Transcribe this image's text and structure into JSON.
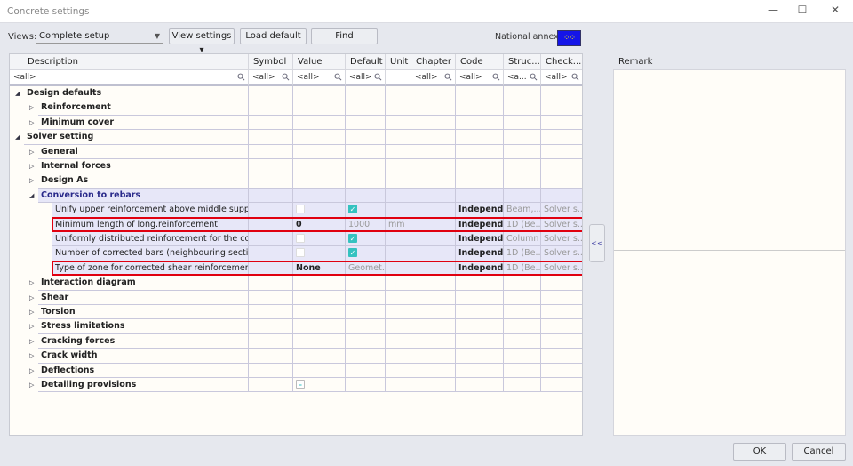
{
  "window": {
    "title": "Concrete settings",
    "minimize": "—",
    "maximize": "☐",
    "close": "✕"
  },
  "toolbar": {
    "views_label": "Views:",
    "views_value": "Complete setup",
    "view_settings": "View settings ▾",
    "load_default": "Load default",
    "find": "Find",
    "national_annex_label": "National annex:",
    "flag_icon": "eu-flag-icon"
  },
  "columns": [
    "Description",
    "Symbol",
    "Value",
    "Default",
    "Unit",
    "Chapter",
    "Code",
    "Struc...",
    "Check..."
  ],
  "filters": [
    "<all>",
    "<all>",
    "<all>",
    "<all>",
    "",
    "<all>",
    "<all>",
    "<a...",
    "<all>"
  ],
  "rows": [
    {
      "level": 0,
      "label": "Design defaults",
      "expanded": true
    },
    {
      "level": 1,
      "label": "Reinforcement"
    },
    {
      "level": 1,
      "label": "Minimum cover"
    },
    {
      "level": 0,
      "label": "Solver setting",
      "expanded": true
    },
    {
      "level": 1,
      "label": "General"
    },
    {
      "level": 1,
      "label": "Internal forces"
    },
    {
      "level": 1,
      "label": "Design As"
    },
    {
      "level": 1,
      "label": "Conversion to rebars",
      "expanded": true,
      "highlight": true
    },
    {
      "level": 2,
      "label": "Unify upper reinforcement above middle support",
      "value_check": "off",
      "default_check": "on",
      "code": "Independ...",
      "struc": "Beam,...",
      "check": "Solver s..."
    },
    {
      "level": 2,
      "label": "Minimum length of long.reinforcement",
      "value": "0",
      "default": "1000",
      "unit": "mm",
      "code": "Independ...",
      "struc": "1D (Be...",
      "check": "Solver s...",
      "boxed": true
    },
    {
      "level": 2,
      "label": "Uniformly distributed reinforcement for the col...",
      "value_check": "off",
      "default_check": "on",
      "code": "Independ...",
      "struc": "Column",
      "check": "Solver s..."
    },
    {
      "level": 2,
      "label": "Number of corrected bars (neighbouring sectio...",
      "value_check": "off",
      "default_check": "on",
      "code": "Independ...",
      "struc": "1D (Be...",
      "check": "Solver s..."
    },
    {
      "level": 2,
      "label": "Type of zone for corrected shear reinforcement",
      "value": "None",
      "default": "Geomet...",
      "code": "Independ...",
      "struc": "1D (Be...",
      "check": "Solver s...",
      "boxed": true
    },
    {
      "level": 1,
      "label": "Interaction diagram"
    },
    {
      "level": 1,
      "label": "Shear"
    },
    {
      "level": 1,
      "label": "Torsion"
    },
    {
      "level": 1,
      "label": "Stress limitations"
    },
    {
      "level": 1,
      "label": "Cracking forces"
    },
    {
      "level": 1,
      "label": "Crack width"
    },
    {
      "level": 1,
      "label": "Deflections"
    },
    {
      "level": 1,
      "label": "Detailing provisions",
      "value_check": "ind"
    }
  ],
  "remark": {
    "label": "Remark"
  },
  "collapse_label": "<<",
  "footer": {
    "ok": "OK",
    "cancel": "Cancel"
  }
}
